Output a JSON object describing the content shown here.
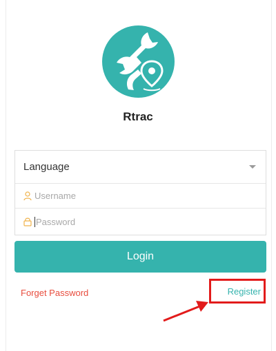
{
  "app": {
    "name": "Rtrac"
  },
  "form": {
    "language_label": "Language",
    "username_placeholder": "Username",
    "password_placeholder": "Password"
  },
  "actions": {
    "login_label": "Login",
    "forget_password_label": "Forget Password",
    "register_label": "Register"
  },
  "colors": {
    "brand": "#35b3ad",
    "forget_link": "#e84c3d",
    "annotation": "#e21b1b"
  },
  "icons": {
    "logo": "wrench-location-pin-icon",
    "language_dropdown": "caret-down-icon",
    "username": "user-icon",
    "password": "lock-icon",
    "annotation": "red-arrow-icon"
  }
}
